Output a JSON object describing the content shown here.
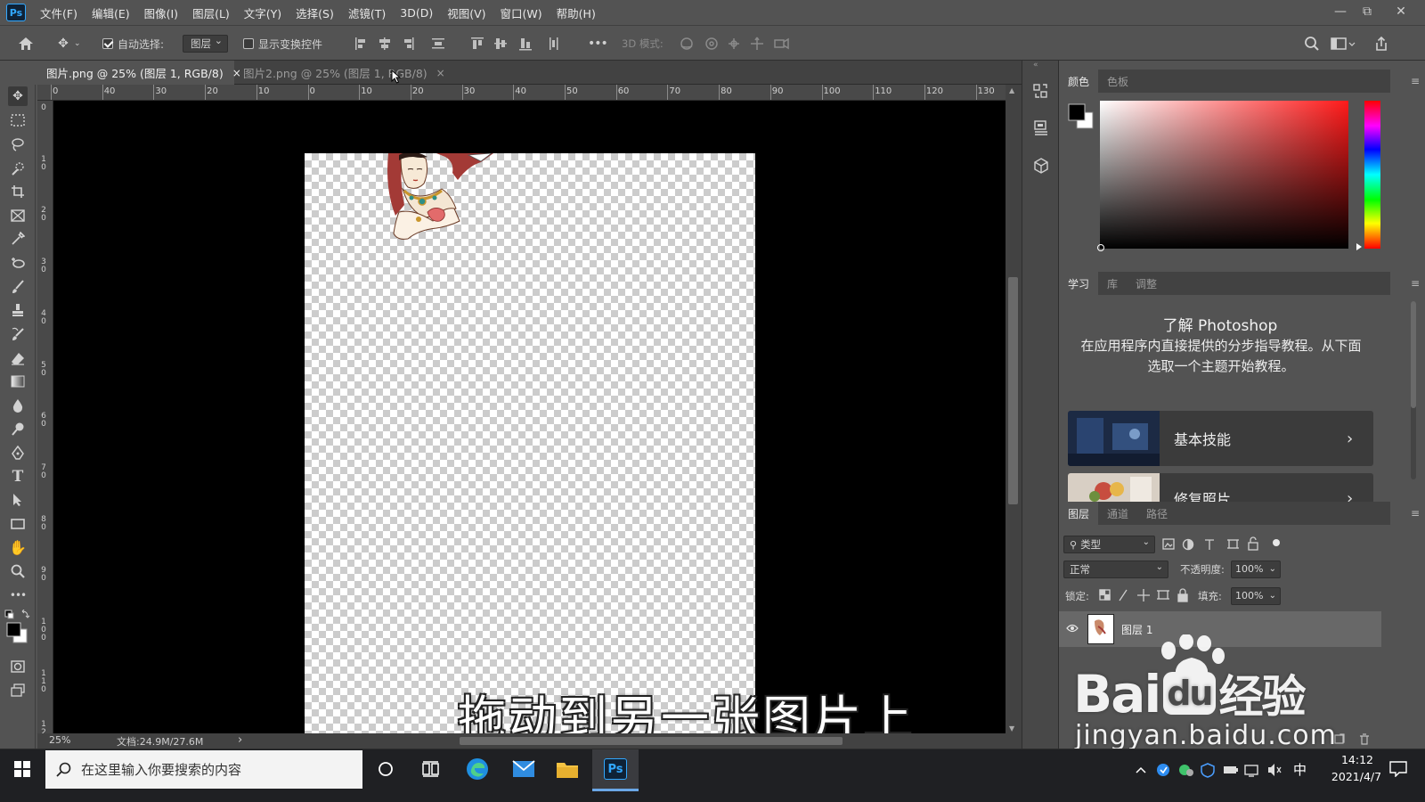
{
  "app": {
    "logo": "Ps"
  },
  "menu": [
    "文件(F)",
    "编辑(E)",
    "图像(I)",
    "图层(L)",
    "文字(Y)",
    "选择(S)",
    "滤镜(T)",
    "3D(D)",
    "视图(V)",
    "窗口(W)",
    "帮助(H)"
  ],
  "window_controls": {
    "minimize": "—",
    "restore": "⧉",
    "close": "✕"
  },
  "options": {
    "auto_select_label": "自动选择:",
    "auto_select_checked": true,
    "auto_select_target": "图层",
    "show_transform_label": "显示变换控件",
    "show_transform_checked": false,
    "more": "•••",
    "mode_3d_label": "3D 模式:"
  },
  "tabs": [
    {
      "label": "图片.png @ 25% (图层 1, RGB/8)",
      "close": "×",
      "active": true
    },
    {
      "label": "图片2.png @ 25% (图层 1, RGB/8)",
      "close": "×",
      "active": false
    }
  ],
  "ruler_top": [
    "0",
    "40",
    "30",
    "20",
    "10",
    "0",
    "10",
    "20",
    "30",
    "40",
    "50",
    "60",
    "70",
    "80",
    "90",
    "100",
    "110",
    "120",
    "130"
  ],
  "ruler_left": [
    "0",
    "1 0",
    "2 0",
    "3 0",
    "4 0",
    "5 0",
    "6 0",
    "7 0",
    "8 0",
    "9 0",
    "1 0 0",
    "1 1 0",
    "1 2"
  ],
  "status": {
    "zoom": "25%",
    "doc": "文档:24.9M/27.6M",
    "arrow": "›"
  },
  "caption": "拖动到另一张图片上",
  "color_panel": {
    "tabs": [
      "颜色",
      "色板"
    ]
  },
  "learn_panel": {
    "tabs": [
      "学习",
      "库",
      "调整"
    ],
    "title": "了解 Photoshop",
    "description": "在应用程序内直接提供的分步指导教程。从下面选取一个主题开始教程。",
    "cards": [
      {
        "label": "基本技能",
        "arrow": "›"
      },
      {
        "label": "修复照片",
        "arrow": "›"
      }
    ]
  },
  "layers_panel": {
    "tabs": [
      "图层",
      "通道",
      "路径"
    ],
    "filter_kind": "类型",
    "blend_mode": "正常",
    "opacity_label": "不透明度:",
    "opacity_value": "100%",
    "lock_label": "锁定:",
    "fill_label": "填充:",
    "fill_value": "100%",
    "layers": [
      {
        "name": "图层 1",
        "visible": true
      }
    ]
  },
  "watermark": {
    "brand": "Bai",
    "brand_du": "du",
    "brand_cn": "经验",
    "url": "jingyan.baidu.com"
  },
  "taskbar": {
    "search_placeholder": "在这里输入你要搜索的内容",
    "ime": "中",
    "time": "14:12",
    "date": "2021/4/7"
  },
  "colors": {
    "accent_ps": "#31a8ff",
    "ui_bg": "#535353",
    "panel_dark": "#424242",
    "foreground": "#000000",
    "background": "#ffffff"
  }
}
